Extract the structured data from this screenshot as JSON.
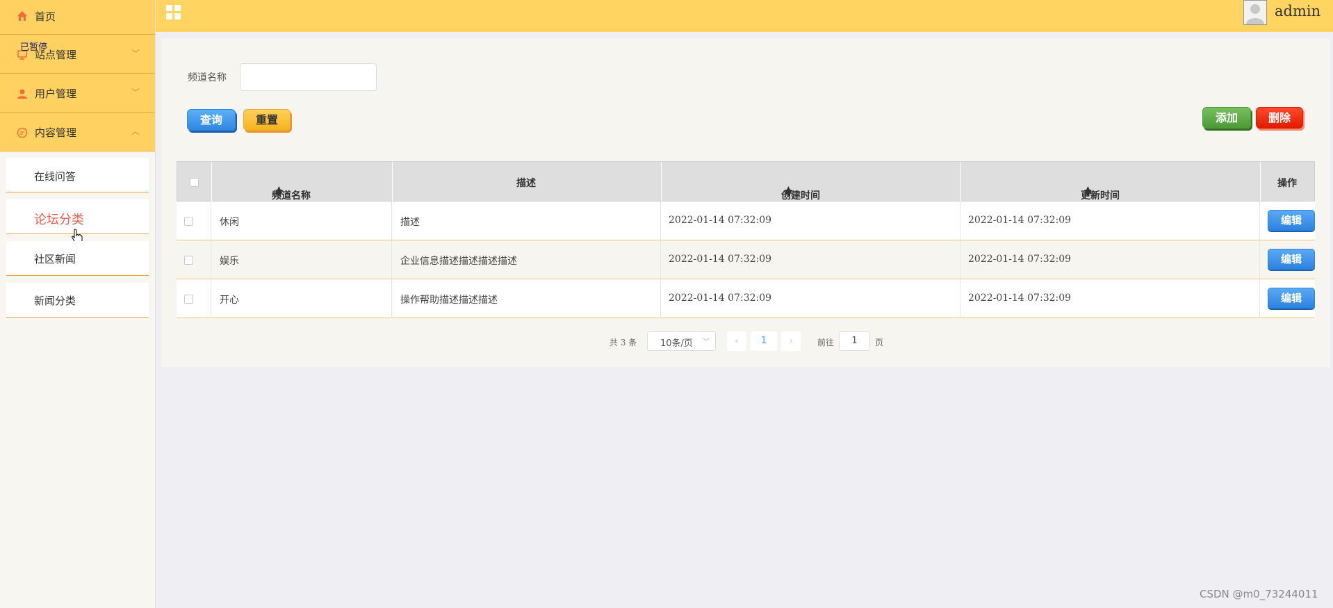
{
  "sidebar": {
    "paused_badge": "已暂停",
    "menu": [
      {
        "label": "首页",
        "icon": "home-icon"
      },
      {
        "label": "站点管理",
        "icon": "monitor-icon"
      },
      {
        "label": "用户管理",
        "icon": "user-icon"
      },
      {
        "label": "内容管理",
        "icon": "message-icon"
      }
    ],
    "submenu": [
      {
        "label": "在线问答"
      },
      {
        "label": "论坛分类"
      },
      {
        "label": "社区新闻"
      },
      {
        "label": "新闻分类"
      }
    ],
    "active_sub": "论坛分类"
  },
  "header": {
    "user_name": "admin"
  },
  "search": {
    "label": "频道名称",
    "value": "",
    "placeholder": ""
  },
  "buttons": {
    "query": "查询",
    "reset": "重置",
    "add": "添加",
    "delete": "删除",
    "edit": "编辑"
  },
  "table": {
    "columns": [
      "频道名称",
      "描述",
      "创建时间",
      "更新时间",
      "操作"
    ],
    "rows": [
      {
        "name": "休闲",
        "desc": "描述",
        "created": "2022-01-14 07:32:09",
        "updated": "2022-01-14 07:32:09"
      },
      {
        "name": "娱乐",
        "desc": "企业信息描述描述描述描述",
        "created": "2022-01-14 07:32:09",
        "updated": "2022-01-14 07:32:09"
      },
      {
        "name": "开心",
        "desc": "操作帮助描述描述描述",
        "created": "2022-01-14 07:32:09",
        "updated": "2022-01-14 07:32:09"
      }
    ]
  },
  "pagination": {
    "total": "共 3 条",
    "page_size": "10条/页",
    "current_page": "1",
    "goto_label": "前往",
    "goto_value": "1",
    "page_suffix": "页"
  },
  "watermark": "CSDN @m0_73244011",
  "colors": {
    "accent": "#ffd161",
    "border_accent": "#f0a63a",
    "active_text": "#e0604f",
    "query_blue": "#2f86e3",
    "add_green": "#4b9a37",
    "delete_red": "#e01a00"
  }
}
